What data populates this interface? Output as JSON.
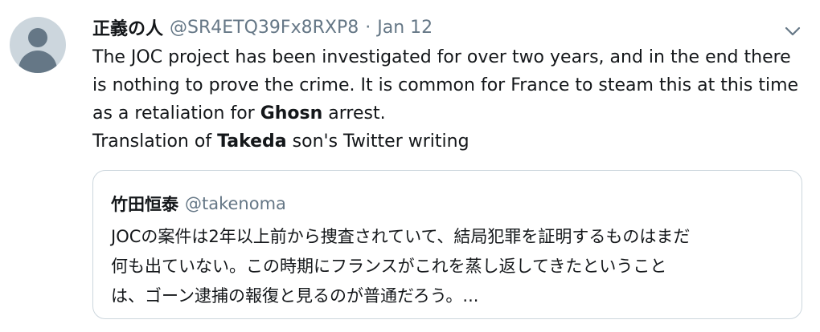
{
  "tweet": {
    "display_name": "正義の人",
    "handle": "@SR4ETQ39Fx8RXP8",
    "separator": "·",
    "date": "Jan 12",
    "text": {
      "p1": "The JOC project has been investigated for over two years, and in the end there is nothing to prove the crime. It is common for France to steam this at this time as a retaliation for ",
      "p1_bold": "Ghosn",
      "p1_end": " arrest.",
      "p2": "Translation of ",
      "p2_bold": "Takeda",
      "p2_end": " son's Twitter writing"
    },
    "menu_icon": "chevron-down-icon"
  },
  "quoted_tweet": {
    "display_name": "竹田恒泰",
    "handle": "@takenoma",
    "lines": [
      "JOCの案件は2年以上前から捜査されていて、結局犯罪を証明するものはまだ",
      "何も出ていない。この時期にフランスがこれを蒸し返してきたということ",
      "は、ゴーン逮捕の報復と見るのが普通だろう。..."
    ]
  },
  "colors": {
    "text": "#14171a",
    "secondary": "#657786",
    "border": "#ccd6dd",
    "avatar_bg": "#ccd6dd"
  }
}
